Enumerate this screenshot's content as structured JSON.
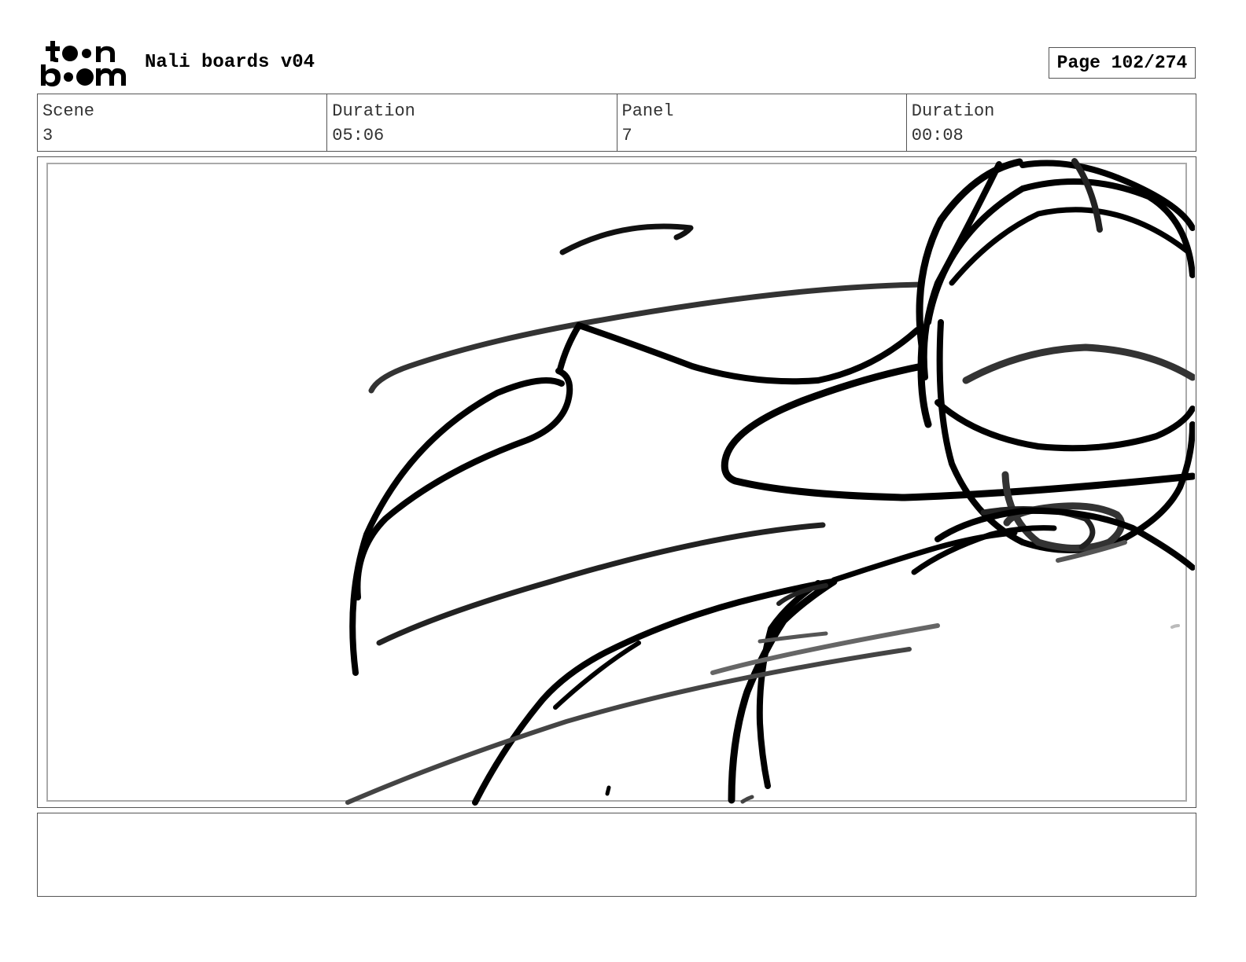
{
  "header": {
    "logo_text": "toon boom",
    "title": "Nali boards v04",
    "page_label": "Page 102/274"
  },
  "info": {
    "scene_label": "Scene",
    "scene_value": "3",
    "scene_duration_label": "Duration",
    "scene_duration_value": "05:06",
    "panel_label": "Panel",
    "panel_value": "7",
    "panel_duration_label": "Duration",
    "panel_duration_value": "00:08"
  },
  "panel": {
    "image": "rough storyboard sketch of a bird-like character head with beak"
  },
  "notes": {
    "text": ""
  }
}
